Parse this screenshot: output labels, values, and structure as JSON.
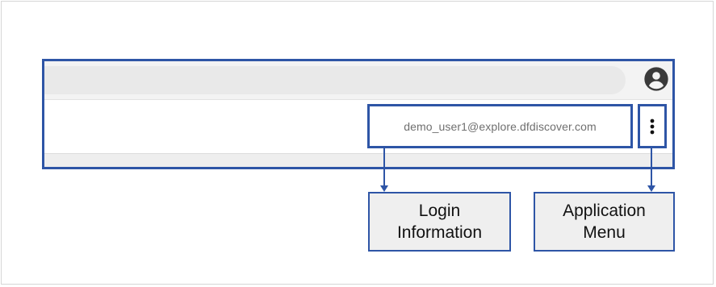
{
  "toolbar": {
    "avatar_icon": "account-circle-icon",
    "login_email": "demo_user1@explore.dfdiscover.com",
    "menu_icon": "more-vertical-icon"
  },
  "callouts": {
    "login": {
      "line1": "Login",
      "line2": "Information"
    },
    "menu": {
      "line1": "Application",
      "line2": "Menu"
    }
  },
  "colors": {
    "annotation_blue": "#2e55a6",
    "callout_bg": "#efefef",
    "topbar_bg": "#f3f3f3",
    "email_text": "#6f6f6f"
  }
}
